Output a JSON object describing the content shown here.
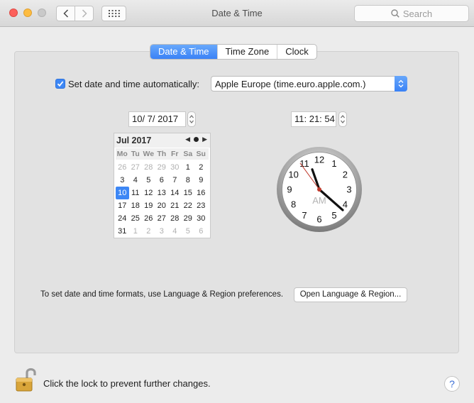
{
  "window": {
    "title": "Date & Time",
    "search_placeholder": "Search"
  },
  "tabs": [
    {
      "label": "Date & Time",
      "active": true
    },
    {
      "label": "Time Zone",
      "active": false
    },
    {
      "label": "Clock",
      "active": false
    }
  ],
  "auto": {
    "label": "Set date and time automatically:",
    "checked": true,
    "server": "Apple Europe (time.euro.apple.com.)"
  },
  "date_field": "10/  7/ 2017",
  "time_field": "11: 21: 54",
  "calendar": {
    "month_label": "Jul 2017",
    "weekdays": [
      "Mo",
      "Tu",
      "We",
      "Th",
      "Fr",
      "Sa",
      "Su"
    ],
    "days": [
      "26",
      "27",
      "28",
      "29",
      "30",
      "1",
      "2",
      "3",
      "4",
      "5",
      "6",
      "7",
      "8",
      "9",
      "10",
      "11",
      "12",
      "13",
      "14",
      "15",
      "16",
      "17",
      "18",
      "19",
      "20",
      "21",
      "22",
      "23",
      "24",
      "25",
      "26",
      "27",
      "28",
      "29",
      "30",
      "31",
      "1",
      "2",
      "3",
      "4",
      "5",
      "6"
    ],
    "muted_indices": [
      0,
      1,
      2,
      3,
      4,
      36,
      37,
      38,
      39,
      40,
      41
    ],
    "selected_index": 14
  },
  "clock": {
    "numbers": [
      "12",
      "1",
      "2",
      "3",
      "4",
      "5",
      "6",
      "7",
      "8",
      "9",
      "10",
      "11"
    ],
    "period": "AM",
    "time": {
      "hours": 11,
      "minutes": 21,
      "seconds": 54
    }
  },
  "formats": {
    "text": "To set date and time formats, use Language & Region preferences.",
    "button_label": "Open Language & Region..."
  },
  "lock": {
    "text": "Click the lock to prevent further changes."
  },
  "help_label": "?",
  "colors": {
    "accent": "#3d87f5",
    "second_hand": "#c0392b"
  }
}
